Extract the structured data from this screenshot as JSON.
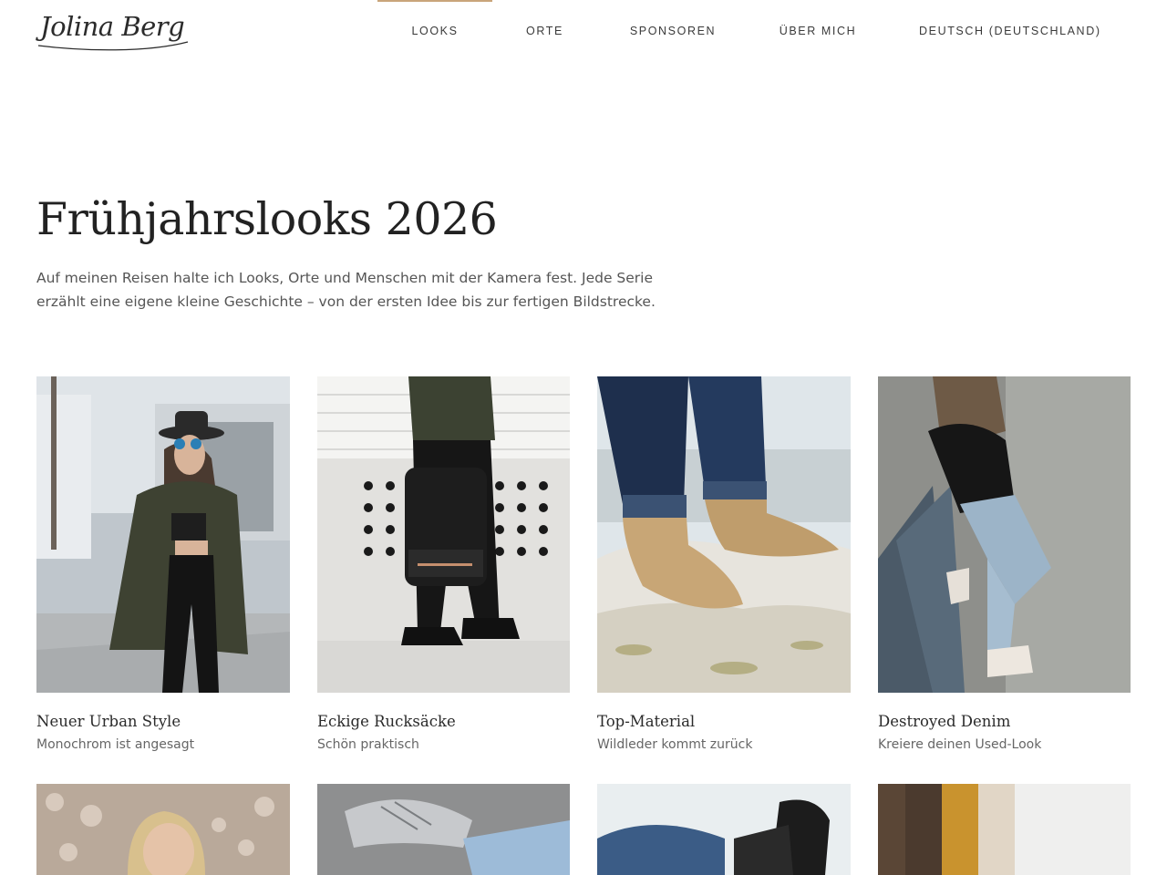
{
  "header": {
    "logo_text": "Jolina Berg",
    "nav": [
      {
        "label": "LOOKS",
        "active": true
      },
      {
        "label": "ORTE"
      },
      {
        "label": "SPONSOREN"
      },
      {
        "label": "ÜBER MICH"
      },
      {
        "label": "DEUTSCH (DEUTSCHLAND)"
      }
    ]
  },
  "hero": {
    "title": "Frühjahrslooks 2026",
    "intro": "Auf meinen Reisen halte ich Looks, Orte und Menschen mit der Kamera fest. Jede Serie erzählt eine eigene kleine Geschichte – von der ersten Idee bis zur fertigen Bildstrecke."
  },
  "gallery": {
    "items": [
      {
        "title": "Neuer Urban Style",
        "subtitle": "Monochrom ist angesagt"
      },
      {
        "title": "Eckige Rucksäcke",
        "subtitle": "Schön praktisch"
      },
      {
        "title": "Top-Material",
        "subtitle": "Wildleder kommt zurück"
      },
      {
        "title": "Destroyed Denim",
        "subtitle": "Kreiere deinen Used-Look"
      }
    ]
  },
  "colors": {
    "accent": "#c9a57a",
    "text": "#2b2b2b",
    "muted": "#666666"
  }
}
